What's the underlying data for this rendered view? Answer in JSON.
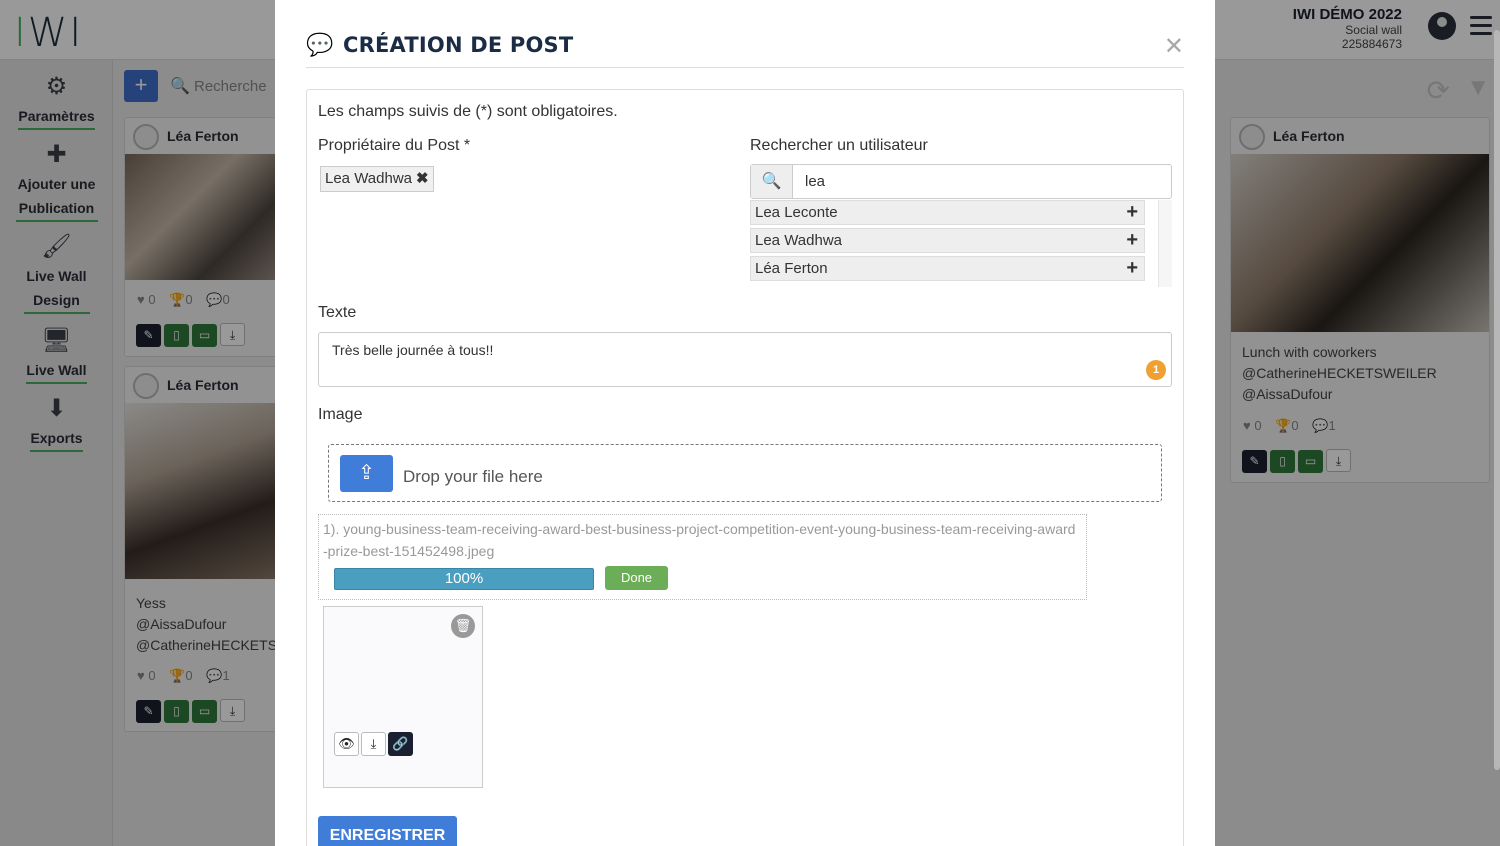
{
  "app": {
    "logo": "IWI",
    "org_name": "IWI DÉMO 2022",
    "org_subtitle": "Social wall",
    "org_id": "225884673"
  },
  "sidebar": {
    "items": [
      {
        "icon": "gear-icon",
        "label": "Paramètres"
      },
      {
        "icon": "plus-icon",
        "label": "Ajouter une Publication"
      },
      {
        "icon": "brush-icon",
        "label": "Live Wall Design"
      },
      {
        "icon": "monitor-icon",
        "label": "Live Wall"
      },
      {
        "icon": "download-icon",
        "label": "Exports"
      }
    ]
  },
  "toolbar": {
    "search_placeholder": "Recherche"
  },
  "cards": [
    {
      "author": "Léa Ferton",
      "likes": "0",
      "trophies": "0",
      "comments": "0"
    },
    {
      "author": "Léa Ferton",
      "caption1": "Yess",
      "caption2": "@AissaDufour",
      "caption3": "@CatherineHECKETS",
      "likes": "0",
      "trophies": "0",
      "comments": "1"
    },
    {
      "author": "Léa Ferton",
      "caption1": "Lunch with coworkers",
      "caption2": "@CatherineHECKETSWEILER",
      "caption3": "@AissaDufour",
      "likes": "0",
      "trophies": "0",
      "comments": "1"
    }
  ],
  "modal": {
    "title": "CRÉATION DE POST",
    "required_note": "Les champs suivis de (*) sont obligatoires.",
    "owner_label": "Propriétaire du Post *",
    "owner_chip": "Lea Wadhwa",
    "search_user_label": "Rechercher un utilisateur",
    "search_user_value": "lea",
    "results": [
      "Lea Leconte",
      "Lea Wadhwa",
      "Léa Ferton"
    ],
    "text_label": "Texte",
    "text_value": "Très belle journée à tous!!",
    "char_badge": "1",
    "image_label": "Image",
    "drop_text": "Drop your file here",
    "file_name": "1). young-business-team-receiving-award-best-business-project-competition-event-young-business-team-receiving-award-prize-best-151452498.jpeg",
    "progress": "100%",
    "progress_fraction": 1.0,
    "done_label": "Done",
    "save_label": "ENREGISTRER"
  },
  "colors": {
    "primary": "#3f7dd8",
    "brand_green": "#4cae5f",
    "dark": "#1b2d44",
    "badge": "#f0a030",
    "done": "#6cad58",
    "progress": "#4a9fc1"
  }
}
